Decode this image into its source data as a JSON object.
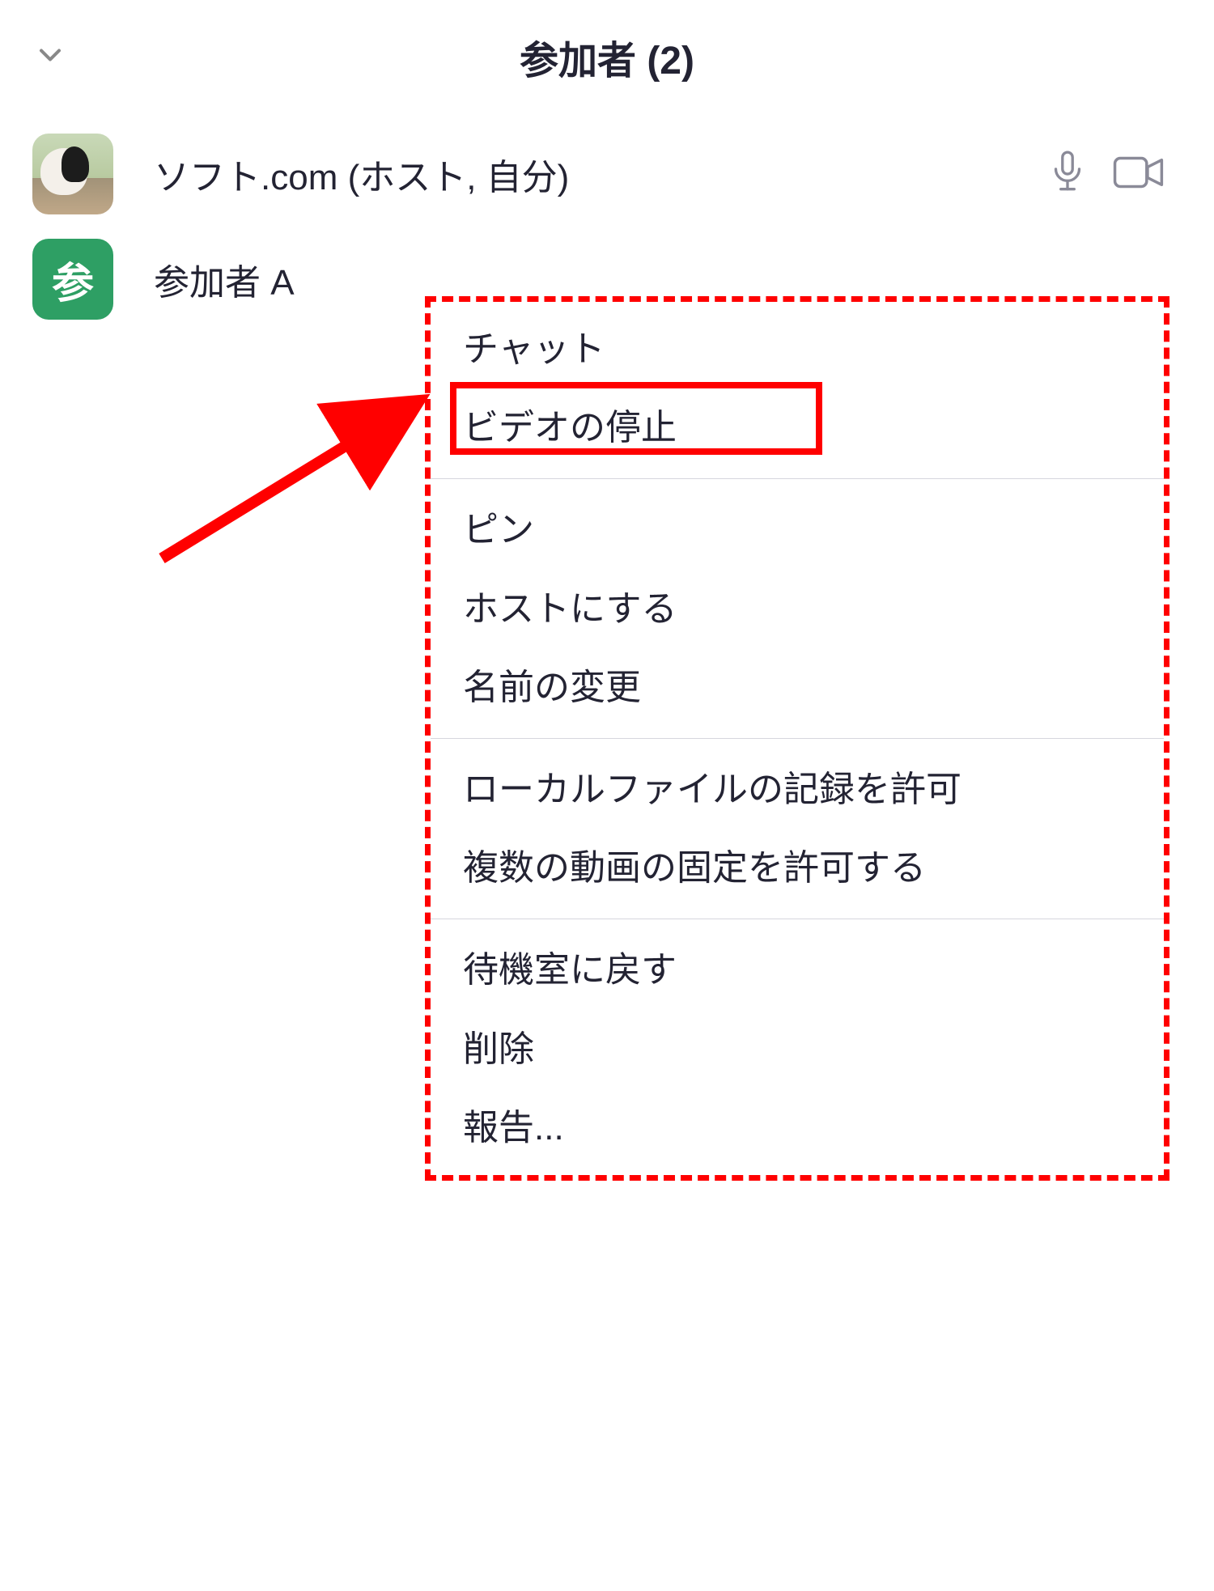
{
  "header": {
    "title": "参加者 (2)"
  },
  "participants": [
    {
      "label": "ソフト.com (ホスト, 自分)",
      "avatar_type": "image",
      "avatar_initial": ""
    },
    {
      "label": "参加者 A",
      "avatar_type": "letter",
      "avatar_initial": "参"
    }
  ],
  "menu": {
    "group1": [
      "チャット",
      "ビデオの停止"
    ],
    "group2": [
      "ピン",
      "ホストにする",
      "名前の変更"
    ],
    "group3": [
      "ローカルファイルの記録を許可",
      "複数の動画の固定を許可する"
    ],
    "group4": [
      "待機室に戻す",
      "削除",
      "報告..."
    ]
  },
  "highlighted_menu_item": "ビデオの停止",
  "colors": {
    "annotation": "#ff0000",
    "avatar_letter_bg": "#2e9f64",
    "icon": "#8a8a98",
    "text": "#232333"
  }
}
